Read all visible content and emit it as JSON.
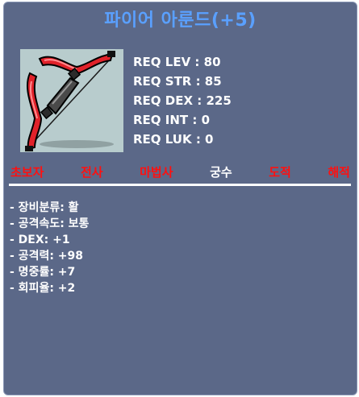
{
  "item": {
    "name": "파이어 아룬드(+5)",
    "icon": "red-bow-icon"
  },
  "requirements": [
    "REQ LEV : 80",
    "REQ STR : 85",
    "REQ DEX : 225",
    "REQ INT : 0",
    "REQ LUK : 0"
  ],
  "jobs": [
    {
      "label": "초보자",
      "allowed": false
    },
    {
      "label": "전사",
      "allowed": false
    },
    {
      "label": "마법사",
      "allowed": false
    },
    {
      "label": "궁수",
      "allowed": true
    },
    {
      "label": "도적",
      "allowed": false
    },
    {
      "label": "해적",
      "allowed": false
    }
  ],
  "stats": [
    "- 장비분류: 활",
    "- 공격속도: 보통",
    "- DEX: +1",
    "- 공격력: +98",
    "- 명중률: +7",
    "- 회피율: +2"
  ],
  "colors": {
    "panel_bg": "#5b6888",
    "title": "#5aa0ff",
    "job_disallowed": "#ff1010",
    "job_allowed": "#ffffff"
  }
}
